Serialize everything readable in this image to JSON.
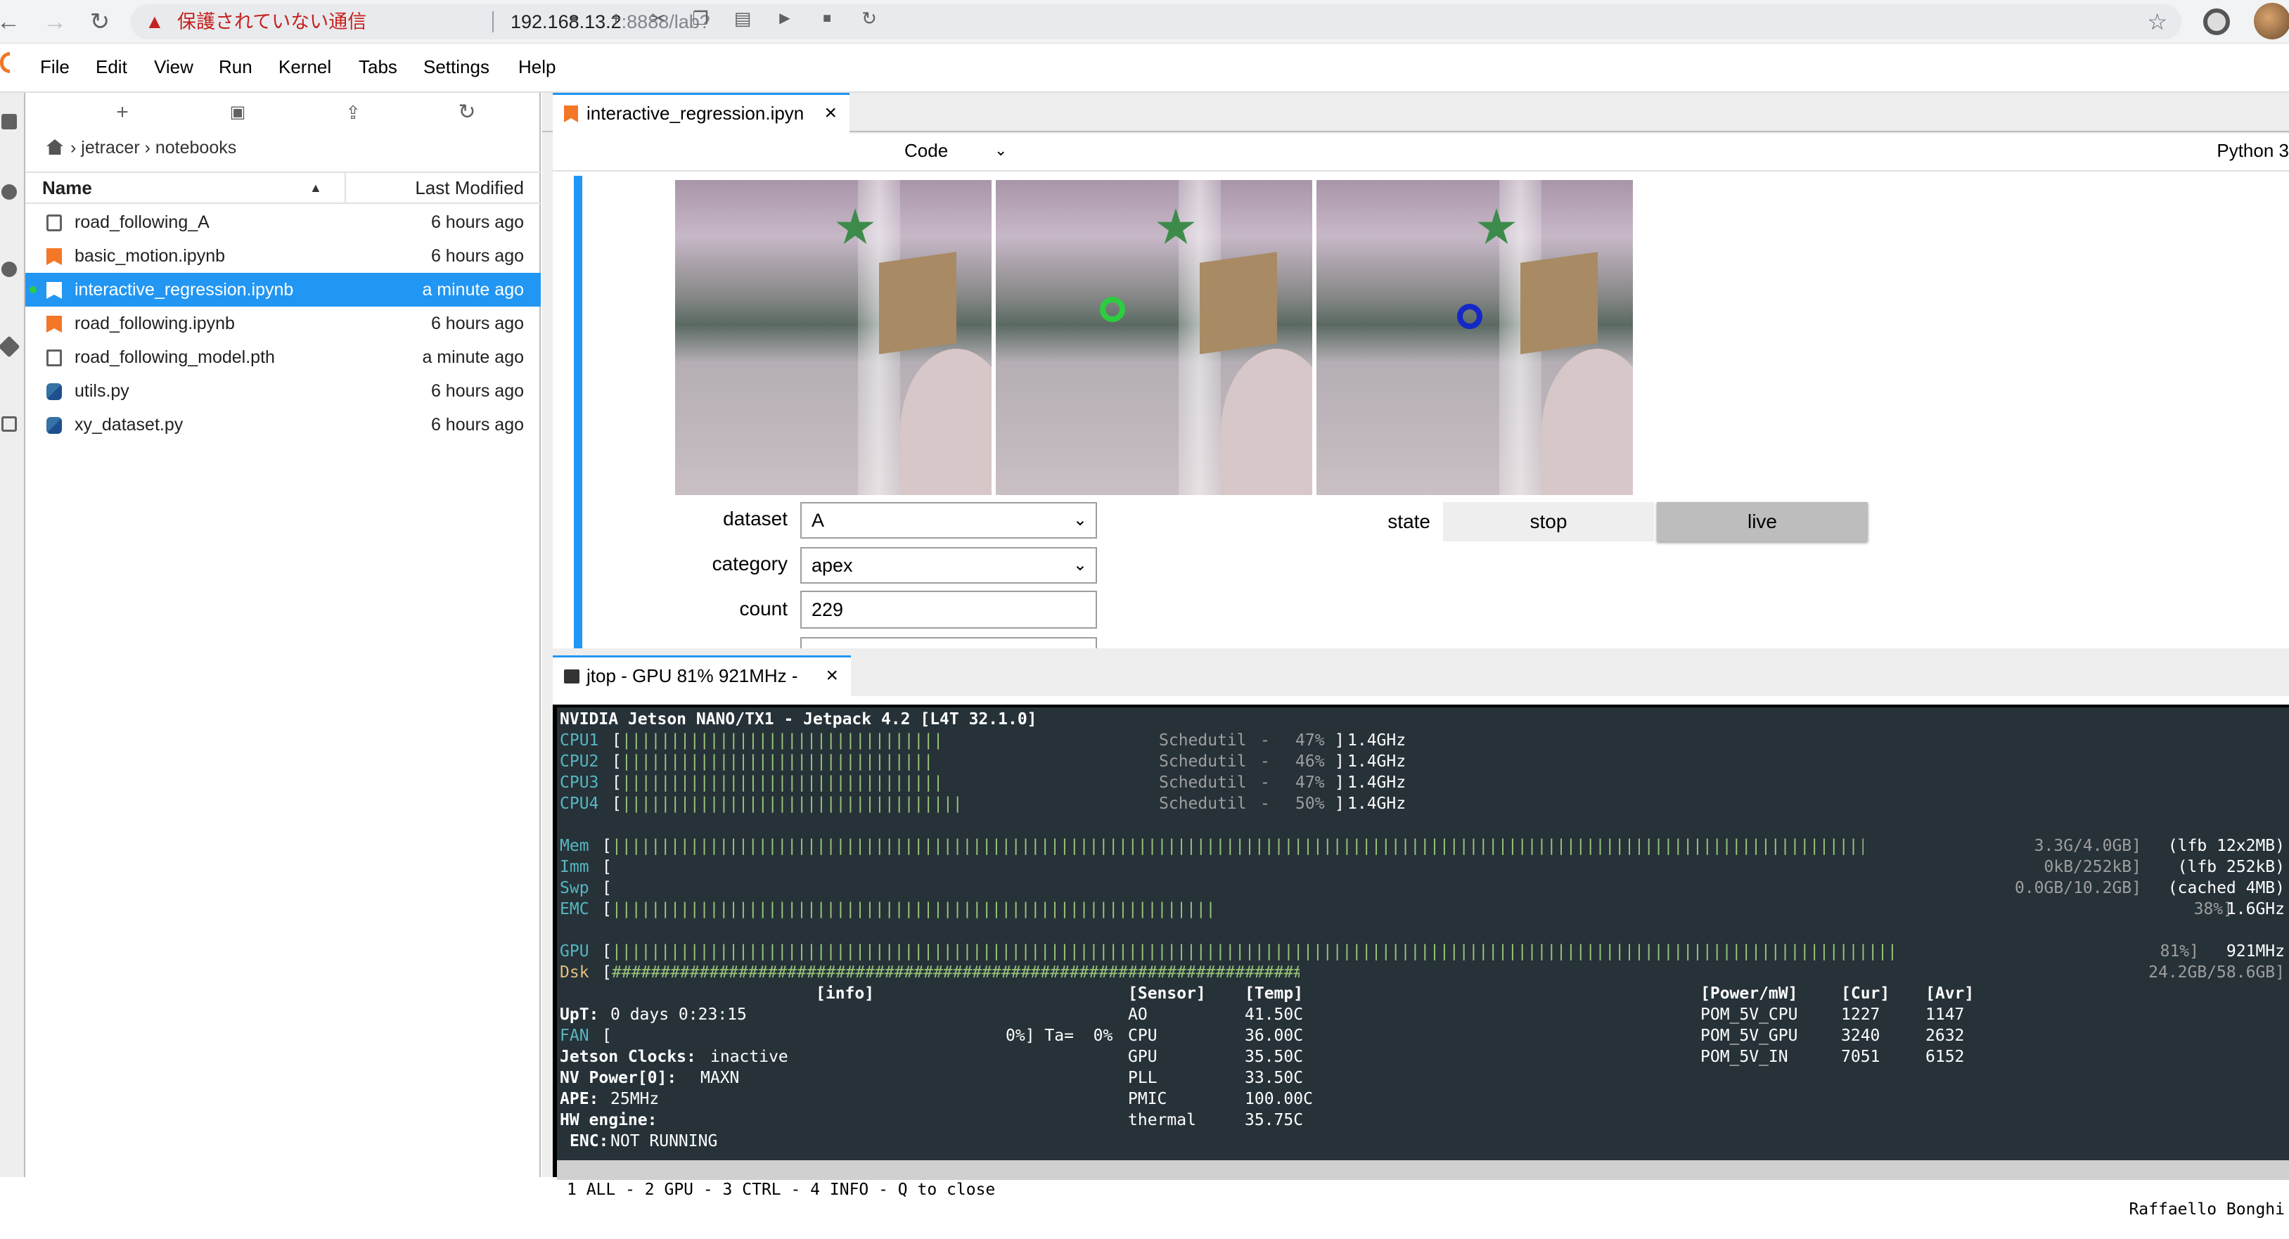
{
  "browser": {
    "security_warning": "保護されていない通信",
    "url_host": "192.168.13.2",
    "url_rest": ":8888/lab?"
  },
  "menu": [
    "File",
    "Edit",
    "View",
    "Run",
    "Kernel",
    "Tabs",
    "Settings",
    "Help"
  ],
  "filebrowser": {
    "breadcrumb": [
      "jetracer",
      "notebooks"
    ],
    "header_name": "Name",
    "header_modified": "Last Modified",
    "files": [
      {
        "name": "road_following_A",
        "modified": "6 hours ago",
        "type": "folder"
      },
      {
        "name": "basic_motion.ipynb",
        "modified": "6 hours ago",
        "type": "notebook"
      },
      {
        "name": "interactive_regression.ipynb",
        "modified": "a minute ago",
        "type": "notebook",
        "selected": true,
        "running": true
      },
      {
        "name": "road_following.ipynb",
        "modified": "6 hours ago",
        "type": "notebook"
      },
      {
        "name": "road_following_model.pth",
        "modified": "a minute ago",
        "type": "file"
      },
      {
        "name": "utils.py",
        "modified": "6 hours ago",
        "type": "python"
      },
      {
        "name": "xy_dataset.py",
        "modified": "6 hours ago",
        "type": "python"
      }
    ]
  },
  "notebook": {
    "tab_title": "interactive_regression.ipyn",
    "cell_type": "Code",
    "kernel": "Python 3",
    "widgets": {
      "dataset_label": "dataset",
      "dataset_value": "A",
      "category_label": "category",
      "category_value": "apex",
      "count_label": "count",
      "count_value": "229",
      "state_label": "state",
      "state_options": [
        "stop",
        "live"
      ],
      "state_selected": "live"
    }
  },
  "terminal": {
    "tab_title": "jtop - GPU 81% 921MHz -",
    "title": "NVIDIA Jetson NANO/TX1 - Jetpack 4.2 [L4T 32.1.0]",
    "cpus": [
      {
        "label": "CPU1",
        "governor": "Schedutil",
        "load": "47%",
        "freq": "1.4GHz"
      },
      {
        "label": "CPU2",
        "governor": "Schedutil",
        "load": "46%",
        "freq": "1.4GHz"
      },
      {
        "label": "CPU3",
        "governor": "Schedutil",
        "load": "47%",
        "freq": "1.4GHz"
      },
      {
        "label": "CPU4",
        "governor": "Schedutil",
        "load": "50%",
        "freq": "1.4GHz"
      }
    ],
    "mem": {
      "label": "Mem",
      "value": "3.3G/4.0GB]",
      "extra": "(lfb 12x2MB)"
    },
    "imm": {
      "label": "Imm",
      "value": "0kB/252kB]",
      "extra": "(lfb 252kB)"
    },
    "swp": {
      "label": "Swp",
      "value": "0.0GB/10.2GB]",
      "extra": "(cached 4MB)"
    },
    "emc": {
      "label": "EMC",
      "value": "38%]",
      "extra": "1.6GHz"
    },
    "gpu": {
      "label": "GPU",
      "value": "81%]",
      "extra": "921MHz"
    },
    "dsk": {
      "label": "Dsk",
      "value": "24.2GB/58.6GB]"
    },
    "info_header": "[info]",
    "uptime_label": "UpT:",
    "uptime": "0 days 0:23:15",
    "fan_label": "FAN",
    "fan_value": "0%] Ta=  0%",
    "jetson_clocks_label": "Jetson Clocks:",
    "jetson_clocks": "inactive",
    "nvpower_label": "NV Power[0]:",
    "nvpower": "MAXN",
    "ape_label": "APE:",
    "ape": "25MHz",
    "hw_engine_label": "HW engine:",
    "enc_label": "ENC:",
    "enc": "NOT RUNNING",
    "sensor_header": "[Sensor]",
    "temp_header": "[Temp]",
    "sensors": [
      {
        "name": "AO",
        "temp": "41.50C"
      },
      {
        "name": "CPU",
        "temp": "36.00C"
      },
      {
        "name": "GPU",
        "temp": "35.50C"
      },
      {
        "name": "PLL",
        "temp": "33.50C"
      },
      {
        "name": "PMIC",
        "temp": "100.00C"
      },
      {
        "name": "thermal",
        "temp": "35.75C"
      }
    ],
    "power_header": "[Power/mW]",
    "cur_header": "[Cur]",
    "avr_header": "[Avr]",
    "power": [
      {
        "name": "POM_5V_CPU",
        "cur": "1227",
        "avr": "1147"
      },
      {
        "name": "POM_5V_GPU",
        "cur": "3240",
        "avr": "2632"
      },
      {
        "name": "POM_5V_IN",
        "cur": "7051",
        "avr": "6152"
      }
    ],
    "status_bar": "1 ALL - 2 GPU - 3 CTRL - 4 INFO - Q to close",
    "author": "Raffaello Bonghi"
  }
}
